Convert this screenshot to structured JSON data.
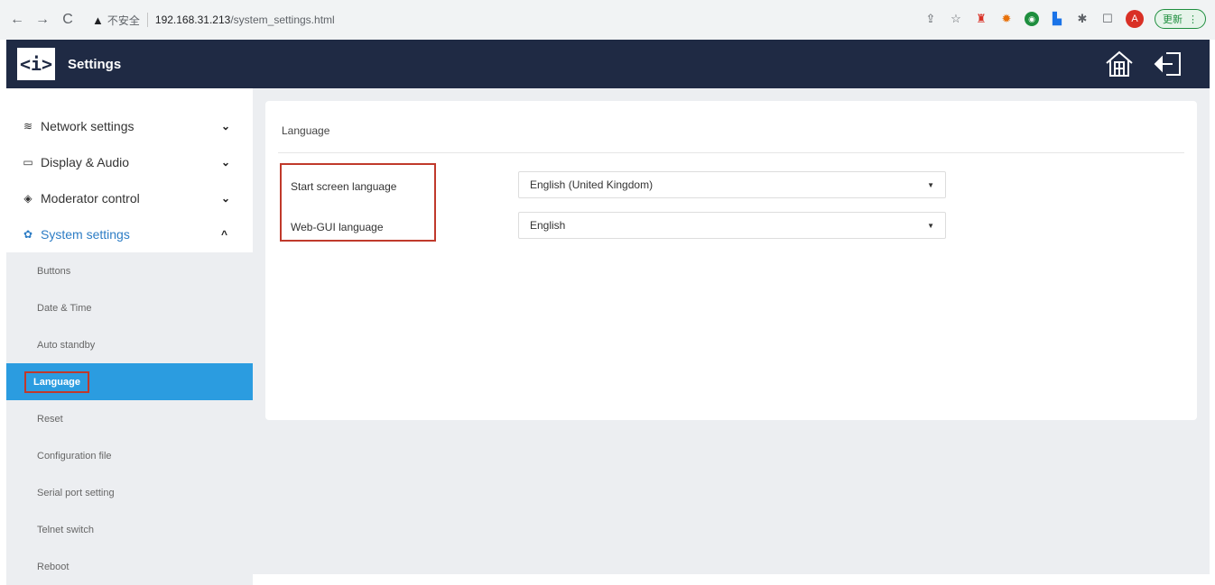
{
  "browser": {
    "back": "←",
    "forward": "→",
    "reload": "C",
    "warning_glyph": "▲",
    "insecure_label": "不安全",
    "url_host": "192.168.31.213",
    "url_path": "/system_settings.html",
    "update_label": "更新",
    "avatar_letter": "A"
  },
  "header": {
    "logo_text": "<i>",
    "title": "Settings"
  },
  "sidebar": {
    "items": [
      {
        "label": "Network settings",
        "icon": "wifi-icon",
        "glyph": "≋"
      },
      {
        "label": "Display & Audio",
        "icon": "monitor-icon",
        "glyph": "▭"
      },
      {
        "label": "Moderator control",
        "icon": "eye-icon",
        "glyph": "◈"
      },
      {
        "label": "System settings",
        "icon": "gear-icon",
        "glyph": "✿"
      }
    ],
    "chevron_down": "⌄",
    "chevron_up": "^",
    "submenu": [
      "Buttons",
      "Date & Time",
      "Auto standby",
      "Language",
      "Reset",
      "Configuration file",
      "Serial port setting",
      "Telnet switch",
      "Reboot"
    ]
  },
  "main": {
    "card_title": "Language",
    "rows": [
      {
        "label": "Start screen language",
        "value": "English (United Kingdom)"
      },
      {
        "label": "Web-GUI language",
        "value": "English"
      }
    ],
    "caret": "▼"
  },
  "colors": {
    "header_bg": "#1f2a44",
    "active_bg": "#2b9ce0",
    "accent": "#2d7dc5",
    "highlight": "#c0392b"
  }
}
